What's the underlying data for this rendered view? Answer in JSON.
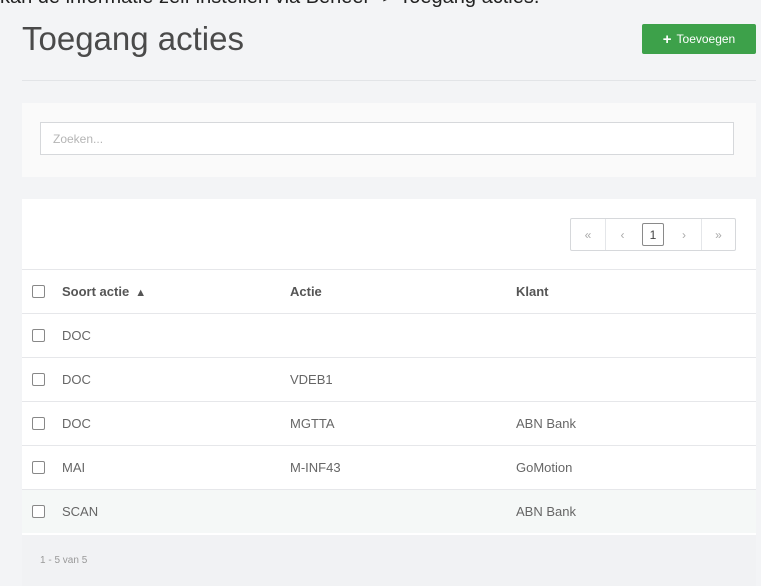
{
  "caption": "kan de informatie zelf instellen via Beheer -> Toegang acties.",
  "page": {
    "title": "Toegang acties",
    "add_button": "Toevoegen"
  },
  "search": {
    "placeholder": "Zoeken..."
  },
  "pagination": {
    "first": "«",
    "prev": "‹",
    "current": "1",
    "next": "›",
    "last": "»"
  },
  "table": {
    "columns": [
      "Soort actie",
      "Actie",
      "Klant"
    ],
    "sort_indicator": "ascending",
    "rows": [
      {
        "soort": "DOC",
        "actie": "",
        "klant": ""
      },
      {
        "soort": "DOC",
        "actie": "VDEB1",
        "klant": ""
      },
      {
        "soort": "DOC",
        "actie": "MGTTA",
        "klant": "ABN Bank"
      },
      {
        "soort": "MAI",
        "actie": "M-INF43",
        "klant": "GoMotion"
      },
      {
        "soort": "SCAN",
        "actie": "",
        "klant": "ABN Bank"
      }
    ]
  },
  "footer": {
    "range": "1 - 5 van 5"
  },
  "colors": {
    "accent": "#3da14a"
  }
}
